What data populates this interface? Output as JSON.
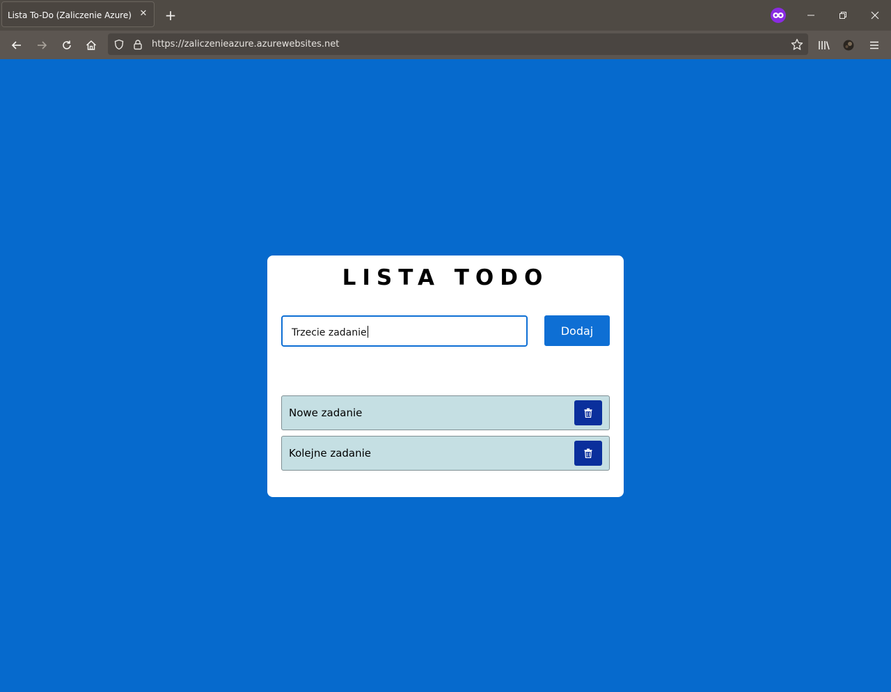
{
  "browser": {
    "tab": {
      "title": "Lista To-Do (Zaliczenie Azure)",
      "close_glyph": "✕"
    },
    "new_tab_glyph": "+",
    "url": "https://zaliczenieazure.azurewebsites.net",
    "icons": {
      "back": "arrow-left-icon",
      "forward": "arrow-right-icon",
      "reload": "reload-icon",
      "home": "home-icon",
      "tracking_protection": "shield-icon",
      "secure": "lock-icon",
      "bookmark": "star-icon",
      "library": "library-icon",
      "account": "account-icon",
      "menu": "hamburger-menu-icon",
      "private_browsing": "private-browsing-mask-icon"
    },
    "colors": {
      "titlebar": "#4f4a44",
      "navbar": "#5c5651",
      "private_badge": "#8a2be2"
    }
  },
  "page": {
    "title": "LISTA TODO",
    "input": {
      "value": "Trzecie zadanie"
    },
    "add_button_label": "Dodaj",
    "tasks": [
      {
        "label": "Nowe zadanie"
      },
      {
        "label": "Kolejne zadanie"
      }
    ],
    "colors": {
      "background": "#066acd",
      "accent": "#0e6fd4",
      "task_background": "#c5dfe3",
      "delete_button": "#0a2f9c"
    }
  }
}
